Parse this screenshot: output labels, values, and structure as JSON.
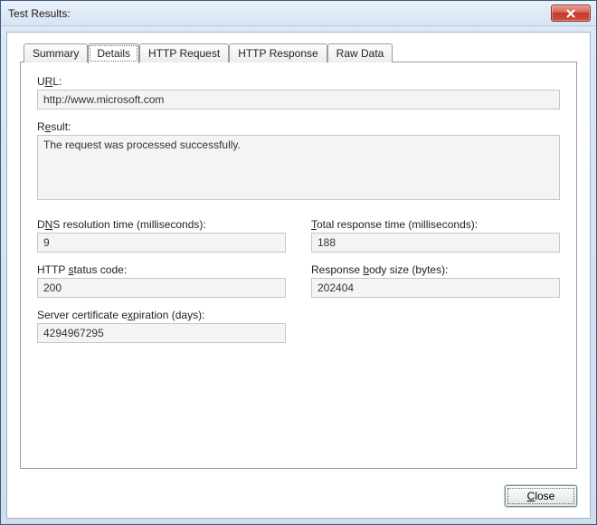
{
  "window": {
    "title": "Test Results:"
  },
  "tabs": {
    "summary": "Summary",
    "details": "Details",
    "http_request": "HTTP Request",
    "http_response": "HTTP Response",
    "raw_data": "Raw Data",
    "active": "details"
  },
  "fields": {
    "url": {
      "label_pre": "U",
      "label_u": "R",
      "label_post": "L:",
      "value": "http://www.microsoft.com"
    },
    "result": {
      "label_pre": "R",
      "label_u": "e",
      "label_post": "sult:",
      "value": "The request was processed successfully."
    },
    "dns": {
      "label_pre": "D",
      "label_u": "N",
      "label_post": "S resolution time (milliseconds):",
      "value": "9"
    },
    "total": {
      "label_u": "T",
      "label_post": "otal response time (milliseconds):",
      "value": "188"
    },
    "status": {
      "label_pre": "HTTP ",
      "label_u": "s",
      "label_post": "tatus code:",
      "value": "200"
    },
    "body": {
      "label_pre": "Response ",
      "label_u": "b",
      "label_post": "ody size (bytes):",
      "value": "202404"
    },
    "cert": {
      "label_pre": "Server certificate e",
      "label_u": "x",
      "label_post": "piration (days):",
      "value": "4294967295"
    }
  },
  "buttons": {
    "close_u": "C",
    "close_post": "lose"
  }
}
